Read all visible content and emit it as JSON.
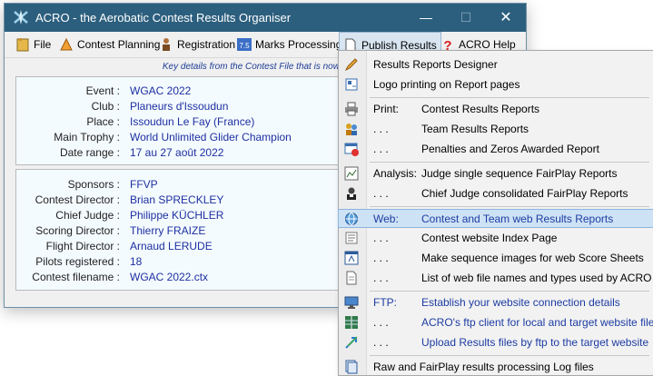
{
  "window": {
    "title": "ACRO - the Aerobatic Contest Results Organiser",
    "minimize_glyph": "—",
    "maximize_glyph": "☐",
    "close_glyph": "✕"
  },
  "menubar": {
    "file": "File",
    "contest_planning": "Contest Planning",
    "registration": "Registration",
    "marks_processing": "Marks Processing",
    "publish_results": "Publish Results",
    "acro_help": "ACRO Help",
    "marks_icon_text": "7.5"
  },
  "notice": "Key details from the Contest File that is now open -",
  "contest": {
    "event_label": "Event :",
    "event": "WGAC 2022",
    "club_label": "Club :",
    "club": "Planeurs d'Issoudun",
    "place_label": "Place :",
    "place": "Issoudun Le Fay (France)",
    "trophy_label": "Main Trophy :",
    "trophy": "World Unlimited Glider Champion",
    "dates_label": "Date range :",
    "dates": "17 au 27 août 2022"
  },
  "officials": {
    "sponsors_label": "Sponsors :",
    "sponsors": "FFVP",
    "director_label": "Contest Director :",
    "director": "Brian SPRECKLEY",
    "chief_judge_label": "Chief Judge :",
    "chief_judge": "Philippe KÜCHLER",
    "scoring_label": "Scoring Director :",
    "scoring": "Thierry FRAIZE",
    "flight_label": "Flight Director :",
    "flight": "Arnaud LERUDE",
    "pilots_label": "Pilots registered :",
    "pilots": "18",
    "filename_label": "Contest filename :",
    "filename": "WGAC 2022.ctx"
  },
  "popup": {
    "designer": "Results Reports Designer",
    "logo": "Logo printing on Report pages",
    "print": "Print:",
    "contest_results": "Contest Results Reports",
    "dots": ". . .",
    "team_results": "Team Results Reports",
    "penalties": "Penalties and Zeros Awarded Report",
    "analysis": "Analysis:",
    "judge_fairplay": "Judge single sequence FairPlay Reports",
    "chief_judge_fairplay": "Chief Judge consolidated FairPlay Reports",
    "web": "Web:",
    "web_reports": "Contest and Team web Results Reports",
    "index_page": "Contest website Index Page",
    "sequence_images": "Make sequence images for web Score Sheets",
    "file_list": "List of web file names and types used by ACRO",
    "ftp": "FTP:",
    "ftp_connection": "Establish your website connection details",
    "ftp_client": "ACRO's ftp client for local and target website files",
    "ftp_upload": "Upload Results files by ftp to the target website",
    "log_files": "Raw and FairPlay results processing Log files"
  }
}
